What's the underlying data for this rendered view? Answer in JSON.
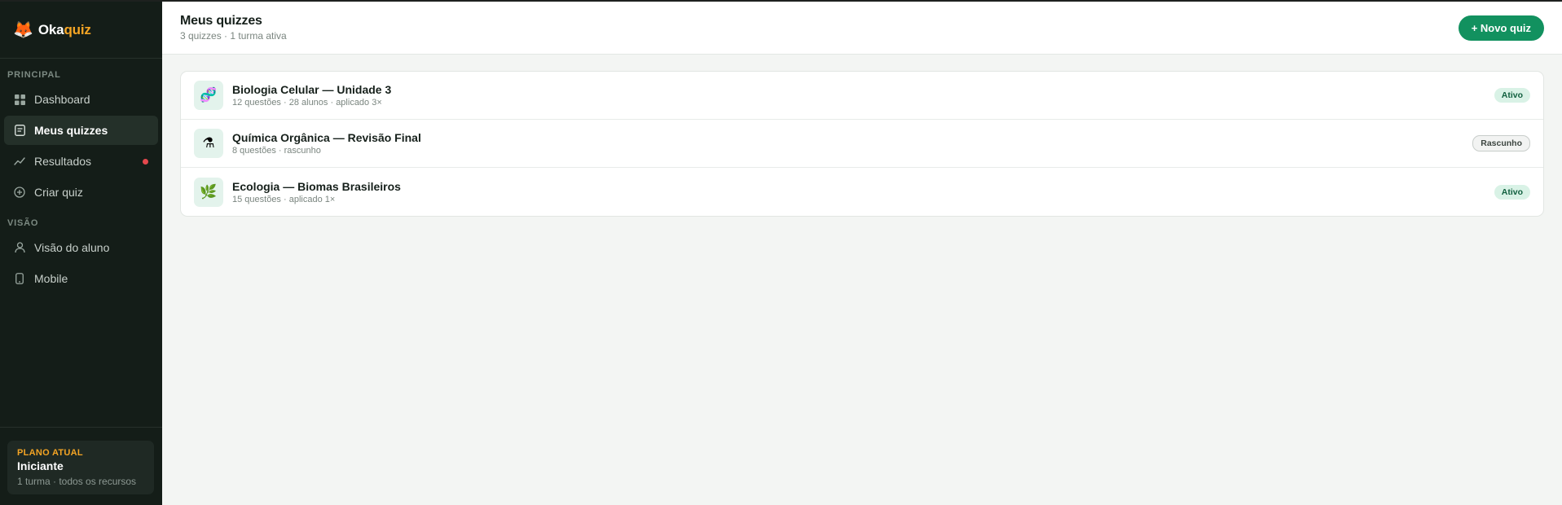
{
  "brand": {
    "icon": "🦊",
    "name_prefix": "Oka",
    "name_accent": "quiz"
  },
  "sidebar": {
    "sections": [
      {
        "label": "PRINCIPAL",
        "items": [
          {
            "label": "Dashboard",
            "icon": "grid-icon",
            "active": false
          },
          {
            "label": "Meus quizzes",
            "icon": "document-icon",
            "active": true
          },
          {
            "label": "Resultados",
            "icon": "trend-icon",
            "active": false,
            "notification": true
          },
          {
            "label": "Criar quiz",
            "icon": "plus-circle-icon",
            "active": false
          }
        ]
      },
      {
        "label": "VISÃO",
        "items": [
          {
            "label": "Visão do aluno",
            "icon": "user-icon",
            "active": false
          },
          {
            "label": "Mobile",
            "icon": "phone-icon",
            "active": false
          }
        ]
      }
    ],
    "plan": {
      "label": "PLANO ATUAL",
      "name": "Iniciante",
      "description": "1 turma · todos os recursos"
    }
  },
  "header": {
    "title": "Meus quizzes",
    "subtitle": "3 quizzes · 1 turma ativa",
    "new_quiz_label": "+ Novo quiz"
  },
  "quizzes": [
    {
      "icon": "🧬",
      "title": "Biologia Celular — Unidade 3",
      "meta": "12 questões · 28 alunos · aplicado 3×",
      "status": "Ativo",
      "status_kind": "ativo"
    },
    {
      "icon": "⚗",
      "title": "Química Orgânica — Revisão Final",
      "meta": "8 questões · rascunho",
      "status": "Rascunho",
      "status_kind": "rascunho"
    },
    {
      "icon": "🌿",
      "title": "Ecologia — Biomas Brasileiros",
      "meta": "15 questões · aplicado 1×",
      "status": "Ativo",
      "status_kind": "ativo"
    }
  ],
  "colors": {
    "accent": "#12915f",
    "brand_accent": "#f5a524",
    "sidebar_bg": "#141d18",
    "notification": "#e5484d"
  }
}
